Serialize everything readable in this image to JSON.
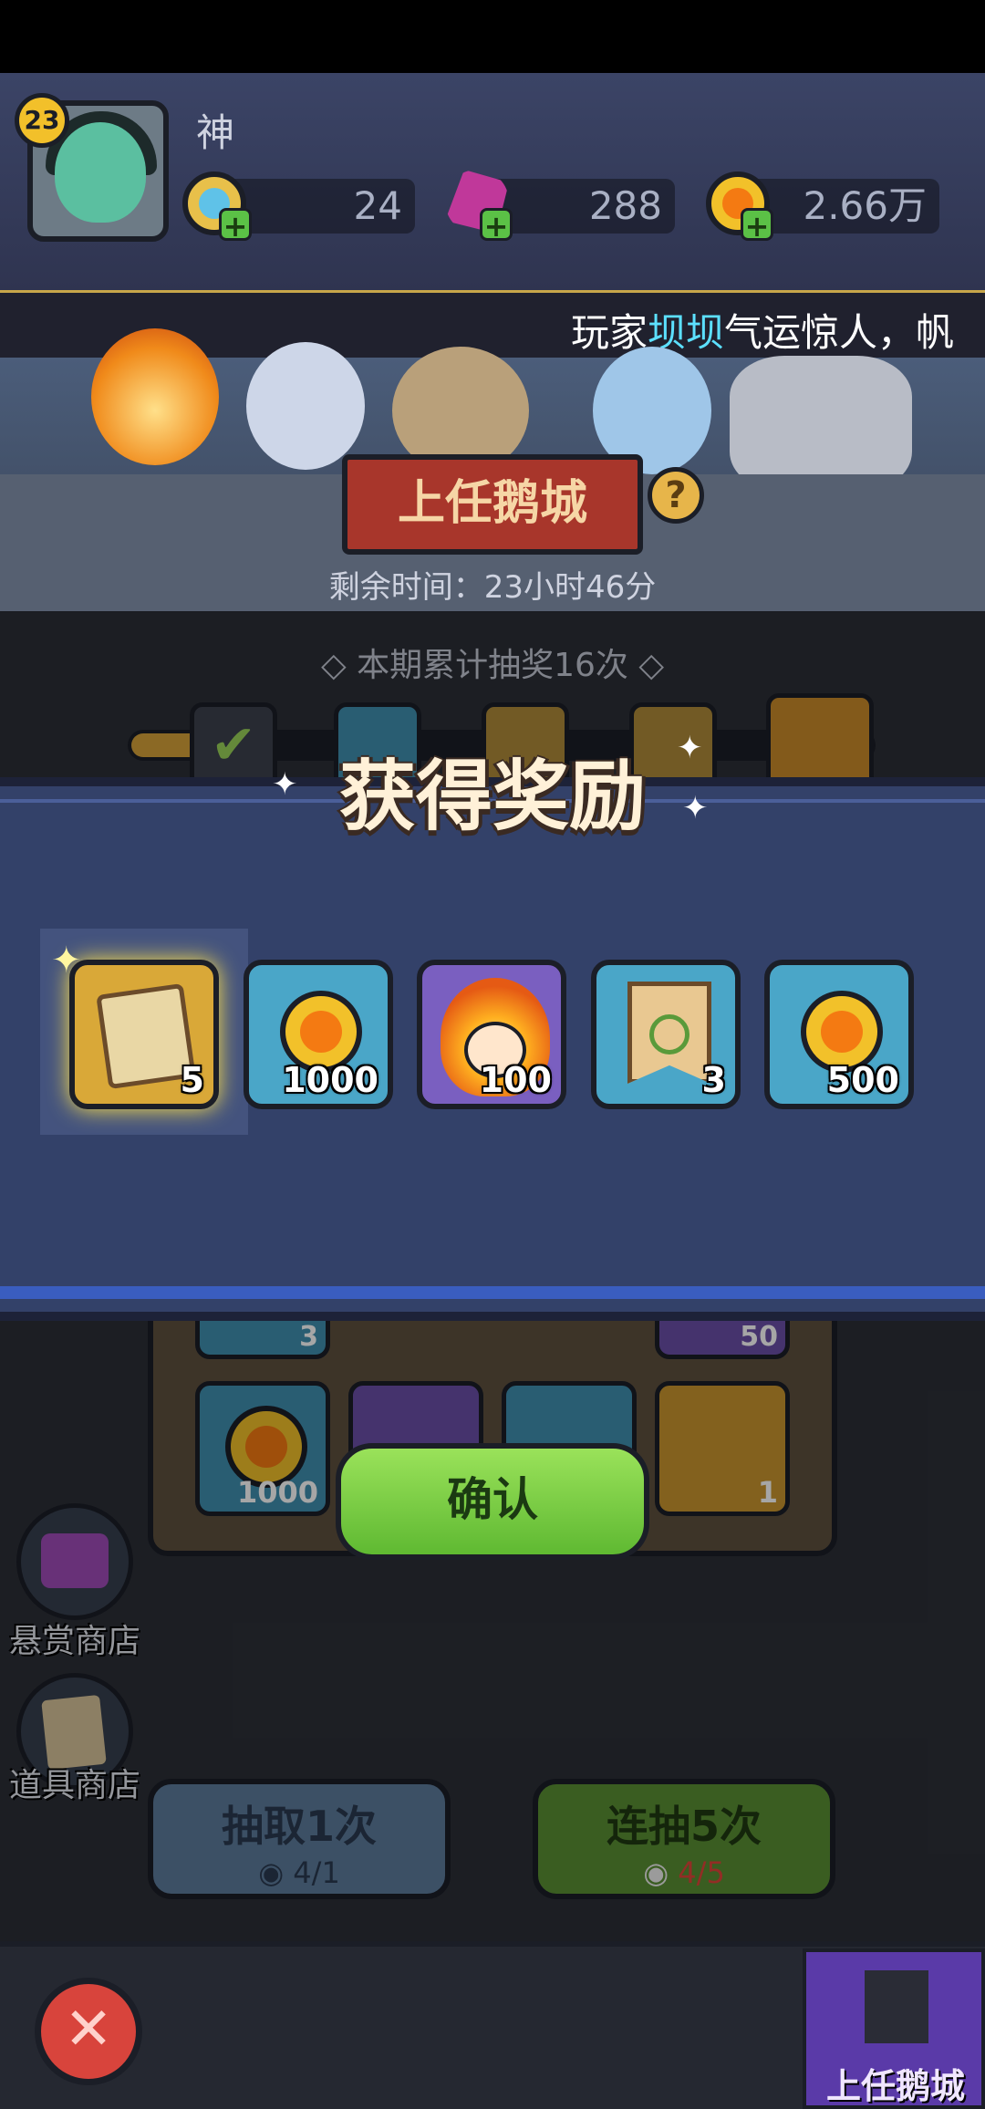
{
  "player": {
    "level": "23",
    "name": "神"
  },
  "resources": [
    {
      "name": "gem-blue",
      "value": "24"
    },
    {
      "name": "gem-pink",
      "value": "288"
    },
    {
      "name": "gold",
      "value": "2.66万"
    }
  ],
  "ticker": {
    "prefix": "玩家",
    "highlight": "坝坝",
    "suffix": "气运惊人，帆"
  },
  "event": {
    "title": "上任鹅城",
    "help": "?",
    "remaining": "剩余时间：23小时46分",
    "accumulated": "本期累计抽奖16次"
  },
  "progress_fraction": 0.12,
  "modal": {
    "title": "获得奖励",
    "rewards": [
      {
        "icon": "scroll-icon",
        "count": "5"
      },
      {
        "icon": "gold-coin-icon",
        "count": "1000"
      },
      {
        "icon": "fire-hero-icon",
        "count": "100"
      },
      {
        "icon": "necklace-banner-icon",
        "count": "3"
      },
      {
        "icon": "gold-coin-icon",
        "count": "500"
      }
    ]
  },
  "grid": {
    "counts": [
      "3",
      "50",
      "1000",
      "1"
    ]
  },
  "confirm_label": "确认",
  "side": {
    "bounty_shop": "悬赏商店",
    "item_shop": "道具商店"
  },
  "draw": {
    "single": {
      "label": "抽取1次",
      "cost": "4/1"
    },
    "multi": {
      "label": "连抽5次",
      "cost": "4/5"
    }
  },
  "bottom": {
    "castle_label": "上任鹅城"
  },
  "colors": {
    "accent_green": "#5fb932",
    "modal_bg": "#334169",
    "ticker_highlight": "#5ce0ff",
    "cost_insufficient": "#e0453a"
  }
}
